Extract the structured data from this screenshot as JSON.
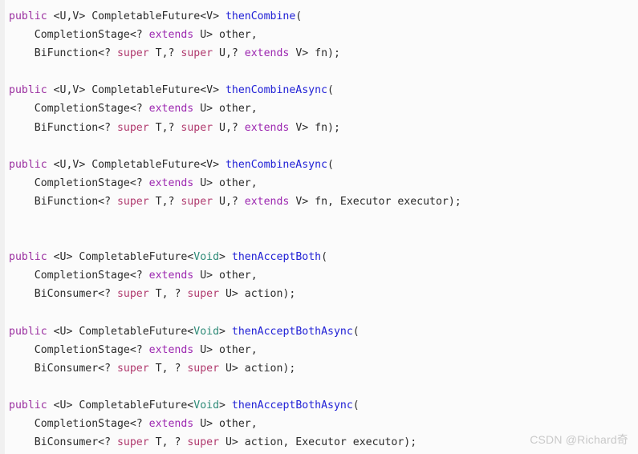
{
  "editor": {
    "language": "java",
    "background_color": "#fbfbfb",
    "gutter_color": "#f0f0f0"
  },
  "colors": {
    "keyword": "#9b30a0",
    "extends_keyword": "#9c27b0",
    "super_keyword": "#b03a6e",
    "method_name": "#2121d6",
    "void_type": "#2e8b78",
    "plain_text": "#2b2b2b",
    "watermark": "#c9c9c9"
  },
  "watermark": {
    "text": "CSDN @Richard奇"
  },
  "code": {
    "lines": [
      {
        "index": 0,
        "tokens": [
          {
            "t": "public",
            "k": "kw"
          },
          {
            "t": " <U,V> CompletableFuture<V> ",
            "k": "plain"
          },
          {
            "t": "thenCombine",
            "k": "method"
          },
          {
            "t": "(",
            "k": "plain"
          }
        ]
      },
      {
        "index": 1,
        "tokens": [
          {
            "t": "    CompletionStage<? ",
            "k": "plain"
          },
          {
            "t": "extends",
            "k": "extends"
          },
          {
            "t": " U> other,",
            "k": "plain"
          }
        ]
      },
      {
        "index": 2,
        "tokens": [
          {
            "t": "    BiFunction<? ",
            "k": "plain"
          },
          {
            "t": "super",
            "k": "super"
          },
          {
            "t": " T,? ",
            "k": "plain"
          },
          {
            "t": "super",
            "k": "super"
          },
          {
            "t": " U,? ",
            "k": "plain"
          },
          {
            "t": "extends",
            "k": "extends"
          },
          {
            "t": " V> fn);",
            "k": "plain"
          }
        ]
      },
      {
        "index": 3,
        "tokens": []
      },
      {
        "index": 4,
        "tokens": [
          {
            "t": "public",
            "k": "kw"
          },
          {
            "t": " <U,V> CompletableFuture<V> ",
            "k": "plain"
          },
          {
            "t": "thenCombineAsync",
            "k": "method"
          },
          {
            "t": "(",
            "k": "plain"
          }
        ]
      },
      {
        "index": 5,
        "tokens": [
          {
            "t": "    CompletionStage<? ",
            "k": "plain"
          },
          {
            "t": "extends",
            "k": "extends"
          },
          {
            "t": " U> other,",
            "k": "plain"
          }
        ]
      },
      {
        "index": 6,
        "tokens": [
          {
            "t": "    BiFunction<? ",
            "k": "plain"
          },
          {
            "t": "super",
            "k": "super"
          },
          {
            "t": " T,? ",
            "k": "plain"
          },
          {
            "t": "super",
            "k": "super"
          },
          {
            "t": " U,? ",
            "k": "plain"
          },
          {
            "t": "extends",
            "k": "extends"
          },
          {
            "t": " V> fn);",
            "k": "plain"
          }
        ]
      },
      {
        "index": 7,
        "tokens": []
      },
      {
        "index": 8,
        "tokens": [
          {
            "t": "public",
            "k": "kw"
          },
          {
            "t": " <U,V> CompletableFuture<V> ",
            "k": "plain"
          },
          {
            "t": "thenCombineAsync",
            "k": "method"
          },
          {
            "t": "(",
            "k": "plain"
          }
        ]
      },
      {
        "index": 9,
        "tokens": [
          {
            "t": "    CompletionStage<? ",
            "k": "plain"
          },
          {
            "t": "extends",
            "k": "extends"
          },
          {
            "t": " U> other,",
            "k": "plain"
          }
        ]
      },
      {
        "index": 10,
        "tokens": [
          {
            "t": "    BiFunction<? ",
            "k": "plain"
          },
          {
            "t": "super",
            "k": "super"
          },
          {
            "t": " T,? ",
            "k": "plain"
          },
          {
            "t": "super",
            "k": "super"
          },
          {
            "t": " U,? ",
            "k": "plain"
          },
          {
            "t": "extends",
            "k": "extends"
          },
          {
            "t": " V> fn, Executor executor);",
            "k": "plain"
          }
        ]
      },
      {
        "index": 11,
        "tokens": []
      },
      {
        "index": 12,
        "tokens": []
      },
      {
        "index": 13,
        "tokens": [
          {
            "t": "public",
            "k": "kw"
          },
          {
            "t": " <U> CompletableFuture<",
            "k": "plain"
          },
          {
            "t": "Void",
            "k": "void"
          },
          {
            "t": "> ",
            "k": "plain"
          },
          {
            "t": "thenAcceptBoth",
            "k": "method"
          },
          {
            "t": "(",
            "k": "plain"
          }
        ]
      },
      {
        "index": 14,
        "tokens": [
          {
            "t": "    CompletionStage<? ",
            "k": "plain"
          },
          {
            "t": "extends",
            "k": "extends"
          },
          {
            "t": " U> other,",
            "k": "plain"
          }
        ]
      },
      {
        "index": 15,
        "tokens": [
          {
            "t": "    BiConsumer<? ",
            "k": "plain"
          },
          {
            "t": "super",
            "k": "super"
          },
          {
            "t": " T, ? ",
            "k": "plain"
          },
          {
            "t": "super",
            "k": "super"
          },
          {
            "t": " U> action);",
            "k": "plain"
          }
        ]
      },
      {
        "index": 16,
        "tokens": []
      },
      {
        "index": 17,
        "tokens": [
          {
            "t": "public",
            "k": "kw"
          },
          {
            "t": " <U> CompletableFuture<",
            "k": "plain"
          },
          {
            "t": "Void",
            "k": "void"
          },
          {
            "t": "> ",
            "k": "plain"
          },
          {
            "t": "thenAcceptBothAsync",
            "k": "method"
          },
          {
            "t": "(",
            "k": "plain"
          }
        ]
      },
      {
        "index": 18,
        "tokens": [
          {
            "t": "    CompletionStage<? ",
            "k": "plain"
          },
          {
            "t": "extends",
            "k": "extends"
          },
          {
            "t": " U> other,",
            "k": "plain"
          }
        ]
      },
      {
        "index": 19,
        "tokens": [
          {
            "t": "    BiConsumer<? ",
            "k": "plain"
          },
          {
            "t": "super",
            "k": "super"
          },
          {
            "t": " T, ? ",
            "k": "plain"
          },
          {
            "t": "super",
            "k": "super"
          },
          {
            "t": " U> action);",
            "k": "plain"
          }
        ]
      },
      {
        "index": 20,
        "tokens": []
      },
      {
        "index": 21,
        "tokens": [
          {
            "t": "public",
            "k": "kw"
          },
          {
            "t": " <U> CompletableFuture<",
            "k": "plain"
          },
          {
            "t": "Void",
            "k": "void"
          },
          {
            "t": "> ",
            "k": "plain"
          },
          {
            "t": "thenAcceptBothAsync",
            "k": "method"
          },
          {
            "t": "(",
            "k": "plain"
          }
        ]
      },
      {
        "index": 22,
        "tokens": [
          {
            "t": "    CompletionStage<? ",
            "k": "plain"
          },
          {
            "t": "extends",
            "k": "extends"
          },
          {
            "t": " U> other,",
            "k": "plain"
          }
        ]
      },
      {
        "index": 23,
        "tokens": [
          {
            "t": "    BiConsumer<? ",
            "k": "plain"
          },
          {
            "t": "super",
            "k": "super"
          },
          {
            "t": " T, ? ",
            "k": "plain"
          },
          {
            "t": "super",
            "k": "super"
          },
          {
            "t": " U> action, Executor executor);",
            "k": "plain"
          }
        ]
      }
    ]
  }
}
